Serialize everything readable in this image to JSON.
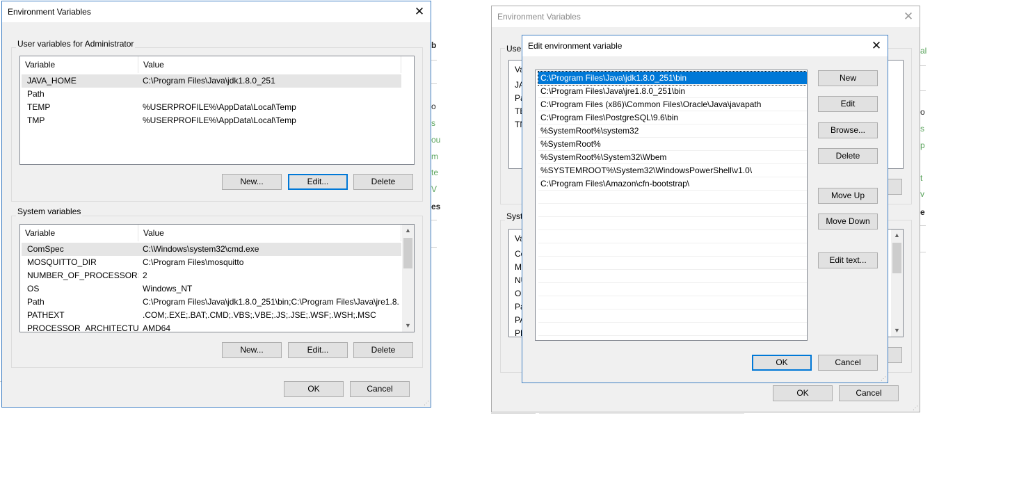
{
  "left_dialog": {
    "title": "Environment Variables",
    "user_group_label": "User variables for Administrator",
    "user_headers": [
      "Variable",
      "Value"
    ],
    "user_rows": [
      {
        "name": "JAVA_HOME",
        "value": "C:\\Program Files\\Java\\jdk1.8.0_251"
      },
      {
        "name": "Path",
        "value": ""
      },
      {
        "name": "TEMP",
        "value": "%USERPROFILE%\\AppData\\Local\\Temp"
      },
      {
        "name": "TMP",
        "value": "%USERPROFILE%\\AppData\\Local\\Temp"
      }
    ],
    "user_buttons": {
      "new": "New...",
      "edit": "Edit...",
      "delete": "Delete"
    },
    "system_group_label": "System variables",
    "system_headers": [
      "Variable",
      "Value"
    ],
    "system_rows": [
      {
        "name": "ComSpec",
        "value": "C:\\Windows\\system32\\cmd.exe"
      },
      {
        "name": "MOSQUITTO_DIR",
        "value": "C:\\Program Files\\mosquitto"
      },
      {
        "name": "NUMBER_OF_PROCESSORS",
        "value": "2"
      },
      {
        "name": "OS",
        "value": "Windows_NT"
      },
      {
        "name": "Path",
        "value": "C:\\Program Files\\Java\\jdk1.8.0_251\\bin;C:\\Program Files\\Java\\jre1.8..."
      },
      {
        "name": "PATHEXT",
        "value": ".COM;.EXE;.BAT;.CMD;.VBS;.VBE;.JS;.JSE;.WSF;.WSH;.MSC"
      },
      {
        "name": "PROCESSOR_ARCHITECTURE",
        "value": "AMD64"
      }
    ],
    "system_buttons": {
      "new": "New...",
      "edit": "Edit...",
      "delete": "Delete"
    },
    "ok": "OK",
    "cancel": "Cancel"
  },
  "right_bg_dialog": {
    "title": "Environment Variables",
    "user_group_label": "User",
    "system_group_label": "Syste",
    "col_header": "Va",
    "user_rows_peek": [
      "JA",
      "Pa",
      "TE",
      "TN"
    ],
    "system_rows_peek": [
      "Co",
      "M",
      "NU",
      "OS",
      "Pa",
      "PA",
      "PR"
    ],
    "ok": "OK",
    "cancel": "Cancel"
  },
  "edit_dialog": {
    "title": "Edit environment variable",
    "entries": [
      "C:\\Program Files\\Java\\jdk1.8.0_251\\bin",
      "C:\\Program Files\\Java\\jre1.8.0_251\\bin",
      "C:\\Program Files (x86)\\Common Files\\Oracle\\Java\\javapath",
      "C:\\Program Files\\PostgreSQL\\9.6\\bin",
      "%SystemRoot%\\system32",
      "%SystemRoot%",
      "%SystemRoot%\\System32\\Wbem",
      "%SYSTEMROOT%\\System32\\WindowsPowerShell\\v1.0\\",
      "C:\\Program Files\\Amazon\\cfn-bootstrap\\"
    ],
    "buttons": {
      "new": "New",
      "edit": "Edit",
      "browse": "Browse...",
      "delete": "Delete",
      "move_up": "Move Up",
      "move_down": "Move Down",
      "edit_text": "Edit text..."
    },
    "ok": "OK",
    "cancel": "Cancel"
  },
  "background_peek": {
    "left_bold": [
      "b",
      "es"
    ],
    "left_green": [
      "s",
      "ou",
      "m",
      "te",
      "V",
      "o"
    ],
    "right_bold": [
      "e"
    ],
    "right_green": [
      "al",
      "o",
      "s",
      "p",
      "t",
      "v"
    ]
  }
}
